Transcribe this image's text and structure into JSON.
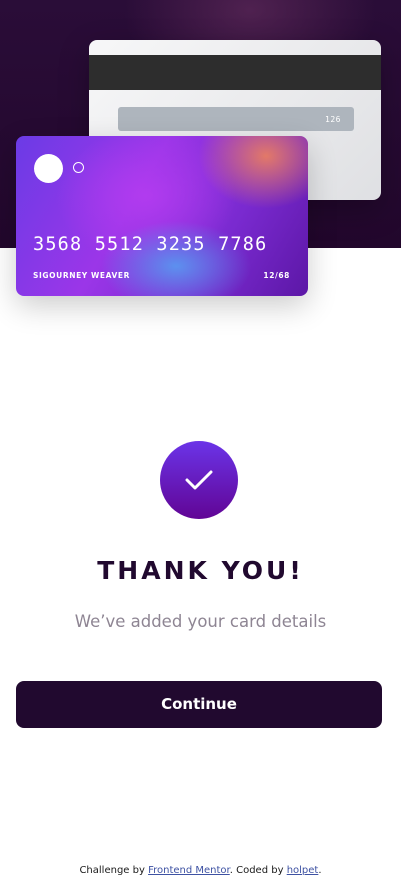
{
  "card_back": {
    "cvc": "126"
  },
  "card_front": {
    "number": "3568 5512 3235 7786",
    "name": "SIGOURNEY WEAVER",
    "expiry": "12/68"
  },
  "complete": {
    "icon": "check-icon",
    "title": "THANK YOU!",
    "message": "We’ve added your card details",
    "button_label": "Continue"
  },
  "footer": {
    "prefix": "Challenge by ",
    "link1_label": "Frontend Mentor",
    "middle": ". Coded by ",
    "link2_label": "holpet",
    "suffix": "."
  },
  "colors": {
    "dark_violet": "#21092f",
    "grayish_violet": "#8e8593",
    "gradient_start": "#6348fe",
    "gradient_end": "#610595"
  }
}
